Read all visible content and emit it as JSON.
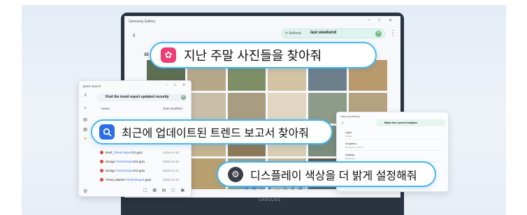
{
  "gallery": {
    "window_title": "Samsung Gallery",
    "window_controls": [
      "–",
      "□",
      "✕"
    ],
    "back_icon": "chevron-left-icon",
    "refresh_label": "Refresh",
    "query": "last weekend",
    "clear_icon": "close-icon",
    "more_icon": "more-vertical-icon",
    "date_number": "30",
    "tile_colors": [
      "#5e6e52",
      "#b8a88a",
      "#7f8f66",
      "#d3c3a2",
      "#6d7f8b",
      "#b99a6c",
      "#9a8a66",
      "#c9bfa9",
      "#a89d81",
      "#e0d6c2",
      "#8e9b88",
      "#b5a27f",
      "#6b7c6b",
      "#c6b38f",
      "#8c7a58",
      "#d8ccb2",
      "#7b8d7c",
      "#a0866a",
      "#4f5f4a",
      "#b8a070",
      "#96a08a",
      "#c7b58e",
      "#69594a",
      "#a8b39a"
    ]
  },
  "quick_search": {
    "title": "Quick search",
    "window_controls": [
      "–",
      "□",
      "✕"
    ],
    "query": "Find the trend report updated recently",
    "col_name": "Name",
    "col_date": "Date Modified",
    "rows": [
      {
        "prefix": "Brief_",
        "highlight": "Trend Report",
        "suffix": "02.pptx",
        "date": "2025-01-26"
      },
      {
        "prefix": "Design ",
        "highlight": "Trend Report",
        "suffix": "03.pptx",
        "date": "2025-01-25"
      },
      {
        "prefix": "Design ",
        "highlight": "Trend Report",
        "suffix": "02.pptx",
        "date": "2025-01-24"
      },
      {
        "prefix": "Trend_Market ",
        "highlight": "Trend Report",
        "suffix": ".pptx",
        "date": "2025-01-23"
      }
    ],
    "rail_icons": [
      "menu-icon",
      "search-icon",
      "document-icon",
      "image-icon",
      "star-icon"
    ],
    "footer_icons": "▢ ▦ ▤ ▢ ▣",
    "settings_icon": "gear-icon"
  },
  "display_settings": {
    "title": "Samsung settings",
    "query": "Make the screen brighter",
    "items": [
      {
        "label": "Light",
        "sub": "Display"
      },
      {
        "label": "Graphics",
        "sub": "Resolution, Refresh"
      },
      {
        "label": "Display",
        "sub": "Brightness"
      },
      {
        "label": "Night Vue",
        "sub": "Off"
      }
    ]
  },
  "prompts": {
    "photos": "지난 주말 사진들을 찾아줘",
    "report": "최근에 업데이트된 트렌드 보고서 찾아줘",
    "display": "디스플레이 색상을 더 밝게 설정해줘"
  },
  "icons": {
    "photos": "gallery-flower-icon",
    "report": "search-icon",
    "display": "gear-icon"
  },
  "taskbar": "◉ ▣ ◎ ◉ ▢ ◍ ◉ ▣ ◉",
  "brand": "SAMSUNG",
  "colors": {
    "pill_border": "#45b7f4",
    "gallery_icon_bg": "#ef3d74",
    "search_icon_bg": "#2b6fe8",
    "settings_icon_bg": "#3a3d45"
  }
}
